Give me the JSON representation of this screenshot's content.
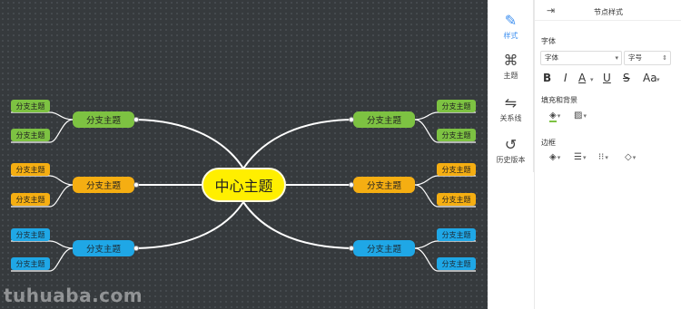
{
  "mindmap": {
    "center": "中心主题",
    "branch_label": "分支主题",
    "branches": [
      {
        "label": "分支主题",
        "color": "green",
        "leaves": [
          "分支主题",
          "分支主题"
        ]
      },
      {
        "label": "分支主题",
        "color": "orange",
        "leaves": [
          "分支主题",
          "分支主题"
        ]
      },
      {
        "label": "分支主题",
        "color": "blue",
        "leaves": [
          "分支主题",
          "分支主题"
        ]
      }
    ],
    "colors": {
      "canvas_bg": "#363a3d",
      "center": "#ffef00",
      "green": "#7dc242",
      "orange": "#f5ae12",
      "blue": "#1fa7e6",
      "line": "#ffffff"
    }
  },
  "watermark": "tuhuaba.com",
  "toolbar": {
    "items": [
      {
        "label": "样式",
        "icon": "paint-brush-icon",
        "active": true
      },
      {
        "label": "主题",
        "icon": "theme-grid-icon"
      },
      {
        "label": "关系线",
        "icon": "relation-line-icon"
      },
      {
        "label": "历史版本",
        "icon": "history-icon"
      }
    ]
  },
  "panel": {
    "title": "节点样式",
    "font_section": "字体",
    "font_family": "字体",
    "font_size": "字号",
    "format_buttons": [
      "B",
      "I",
      "A",
      "U",
      "S",
      "Aa"
    ],
    "fill_section": "填充和背景",
    "border_section": "边框"
  }
}
